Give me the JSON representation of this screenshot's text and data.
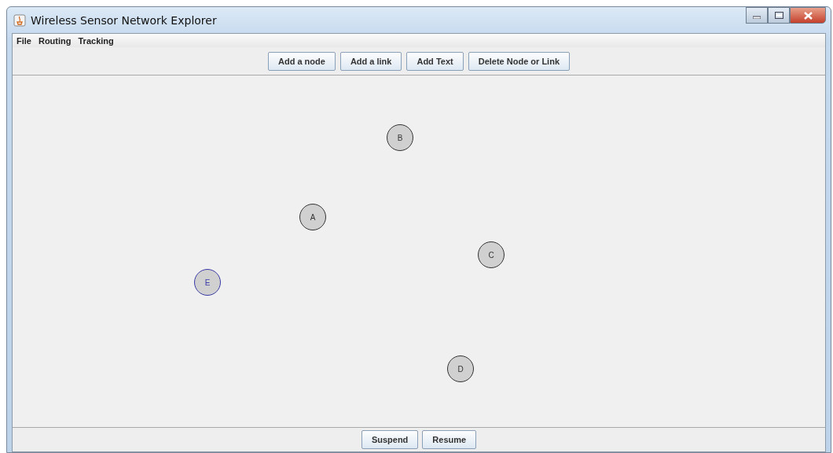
{
  "window": {
    "title": "Wireless Sensor Network Explorer"
  },
  "menu": [
    "File",
    "Routing",
    "Tracking"
  ],
  "toolbar": [
    "Add a node",
    "Add a link",
    "Add Text",
    "Delete Node or Link"
  ],
  "nodes": [
    {
      "label": "B",
      "selected": false
    },
    {
      "label": "A",
      "selected": false
    },
    {
      "label": "C",
      "selected": false
    },
    {
      "label": "E",
      "selected": true
    },
    {
      "label": "D",
      "selected": false
    }
  ],
  "bottom_buttons": [
    "Suspend",
    "Resume"
  ]
}
